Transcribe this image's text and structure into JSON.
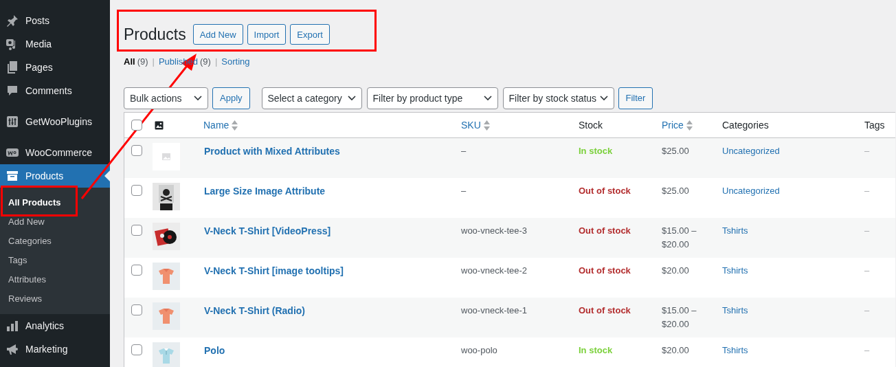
{
  "sidebar": {
    "items": [
      {
        "label": "Posts",
        "selected": false
      },
      {
        "label": "Media",
        "selected": false
      },
      {
        "label": "Pages",
        "selected": false
      },
      {
        "label": "Comments",
        "selected": false
      },
      {
        "label": "GetWooPlugins",
        "selected": false
      },
      {
        "label": "WooCommerce",
        "selected": false
      },
      {
        "label": "Products",
        "selected": true,
        "children": [
          {
            "label": "All Products",
            "selected": true
          },
          {
            "label": "Add New",
            "selected": false
          },
          {
            "label": "Categories",
            "selected": false
          },
          {
            "label": "Tags",
            "selected": false
          },
          {
            "label": "Attributes",
            "selected": false
          },
          {
            "label": "Reviews",
            "selected": false
          }
        ]
      },
      {
        "label": "Analytics",
        "selected": false
      },
      {
        "label": "Marketing",
        "selected": false
      }
    ]
  },
  "page": {
    "title": "Products",
    "actions": [
      "Add New",
      "Import",
      "Export"
    ]
  },
  "views": [
    {
      "label": "All",
      "count": "(9)",
      "selected": true,
      "divider": "|"
    },
    {
      "label": "Published",
      "count": "(9)",
      "selected": false,
      "divider": "|"
    },
    {
      "label": "Sorting",
      "selected": false
    }
  ],
  "filters": {
    "bulk": "Bulk actions",
    "apply": "Apply",
    "selects": [
      "Select a category",
      "Filter by product type",
      "Filter by stock status"
    ],
    "filter": "Filter"
  },
  "table": {
    "select_all_checked": false,
    "columns": [
      {
        "label": "Name",
        "sortable": true
      },
      {
        "label": "SKU",
        "sortable": true
      },
      {
        "label": "Stock",
        "sortable": false
      },
      {
        "label": "Price",
        "sortable": true
      },
      {
        "label": "Categories",
        "sortable": false
      },
      {
        "label": "Tags",
        "sortable": false
      }
    ],
    "rows": [
      {
        "thumbnail": {
          "kind": "placeholder"
        },
        "name": "Product with Mixed Attributes",
        "sku": "–",
        "stock": {
          "text": "In stock",
          "color": "#7ad03a"
        },
        "price": [
          "$25.00"
        ],
        "category": "Uncategorized",
        "tags": "–",
        "checked": false
      },
      {
        "thumbnail": {
          "kind": "picture"
        },
        "name": "Large Size Image Attribute",
        "sku": "–",
        "stock": {
          "text": "Out of stock",
          "color": "#b32d2e"
        },
        "price": [
          "$25.00"
        ],
        "category": "Uncategorized",
        "tags": "–",
        "checked": false
      },
      {
        "thumbnail": {
          "kind": "picture"
        },
        "name": "V-Neck T-Shirt [VideoPress]",
        "sku": "woo-vneck-tee-3",
        "stock": {
          "text": "Out of stock",
          "color": "#b32d2e"
        },
        "price": [
          "$15.00 –",
          "$20.00"
        ],
        "category": "Tshirts",
        "tags": "–",
        "checked": false
      },
      {
        "thumbnail": {
          "kind": "picture"
        },
        "name": "V-Neck T-Shirt [image tooltips]",
        "sku": "woo-vneck-tee-2",
        "stock": {
          "text": "Out of stock",
          "color": "#b32d2e"
        },
        "price": [
          "$20.00"
        ],
        "category": "Tshirts",
        "tags": "–",
        "checked": false
      },
      {
        "thumbnail": {
          "kind": "picture"
        },
        "name": "V-Neck T-Shirt (Radio)",
        "sku": "woo-vneck-tee-1",
        "stock": {
          "text": "Out of stock",
          "color": "#b32d2e"
        },
        "price": [
          "$15.00 –",
          "$20.00"
        ],
        "category": "Tshirts",
        "tags": "–",
        "checked": false
      },
      {
        "thumbnail": {
          "kind": "picture"
        },
        "name": "Polo",
        "sku": "woo-polo",
        "stock": {
          "text": "In stock",
          "color": "#7ad03a"
        },
        "price": [
          "$20.00"
        ],
        "category": "Tshirts",
        "tags": "–",
        "checked": false
      }
    ]
  }
}
